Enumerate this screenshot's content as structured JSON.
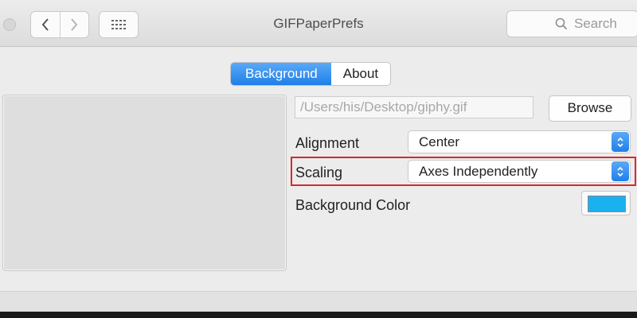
{
  "window": {
    "title": "GIFPaperPrefs"
  },
  "toolbar": {
    "back_icon": "chevron-left-icon",
    "forward_icon": "chevron-right-icon",
    "grid_icon": "grid-icon",
    "search_placeholder": "Search"
  },
  "tabs": [
    {
      "label": "Background",
      "active": true
    },
    {
      "label": "About",
      "active": false
    }
  ],
  "file": {
    "path": "/Users/his/Desktop/giphy.gif",
    "browse_label": "Browse"
  },
  "alignment": {
    "label": "Alignment",
    "value": "Center"
  },
  "scaling": {
    "label": "Scaling",
    "value": "Axes Independently"
  },
  "background_color": {
    "label": "Background Color",
    "color": "#1ab1f0"
  },
  "colors": {
    "accent": "#2a8af0",
    "highlight": "#d7282f"
  }
}
